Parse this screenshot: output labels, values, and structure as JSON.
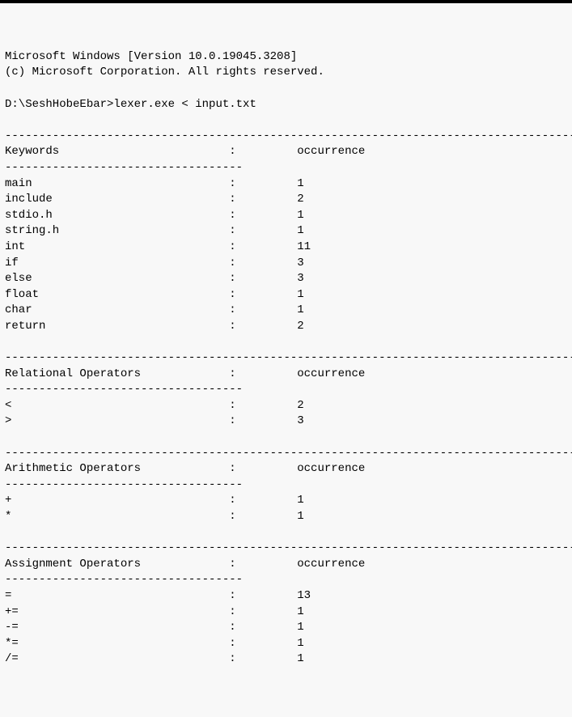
{
  "header": {
    "version_line": "Microsoft Windows [Version 10.0.19045.3208]",
    "copyright_line": "(c) Microsoft Corporation. All rights reserved."
  },
  "prompt": "D:\\SeshHobeEbar>lexer.exe < input.txt",
  "sections": [
    {
      "title": "Keywords",
      "occ_label": "occurrence",
      "rows": [
        {
          "name": "main",
          "count": "1"
        },
        {
          "name": "include",
          "count": "2"
        },
        {
          "name": "stdio.h",
          "count": "1"
        },
        {
          "name": "string.h",
          "count": "1"
        },
        {
          "name": "int",
          "count": "11"
        },
        {
          "name": "if",
          "count": "3"
        },
        {
          "name": "else",
          "count": "3"
        },
        {
          "name": "float",
          "count": "1"
        },
        {
          "name": "char",
          "count": "1"
        },
        {
          "name": "return",
          "count": "2"
        }
      ]
    },
    {
      "title": "Relational Operators",
      "occ_label": "occurrence",
      "rows": [
        {
          "name": "<",
          "count": "2"
        },
        {
          "name": ">",
          "count": "3"
        }
      ]
    },
    {
      "title": "Arithmetic Operators",
      "occ_label": "occurrence",
      "rows": [
        {
          "name": "+",
          "count": "1"
        },
        {
          "name": "*",
          "count": "1"
        }
      ]
    },
    {
      "title": "Assignment Operators",
      "occ_label": "occurrence",
      "rows": [
        {
          "name": "=",
          "count": "13"
        },
        {
          "name": "+=",
          "count": "1"
        },
        {
          "name": "-=",
          "count": "1"
        },
        {
          "name": "*=",
          "count": "1"
        },
        {
          "name": "/=",
          "count": "1"
        }
      ]
    }
  ],
  "layout": {
    "colon_col": 33,
    "occ_col": 43,
    "long_dash_len": 84,
    "short_dash_len": 35
  }
}
